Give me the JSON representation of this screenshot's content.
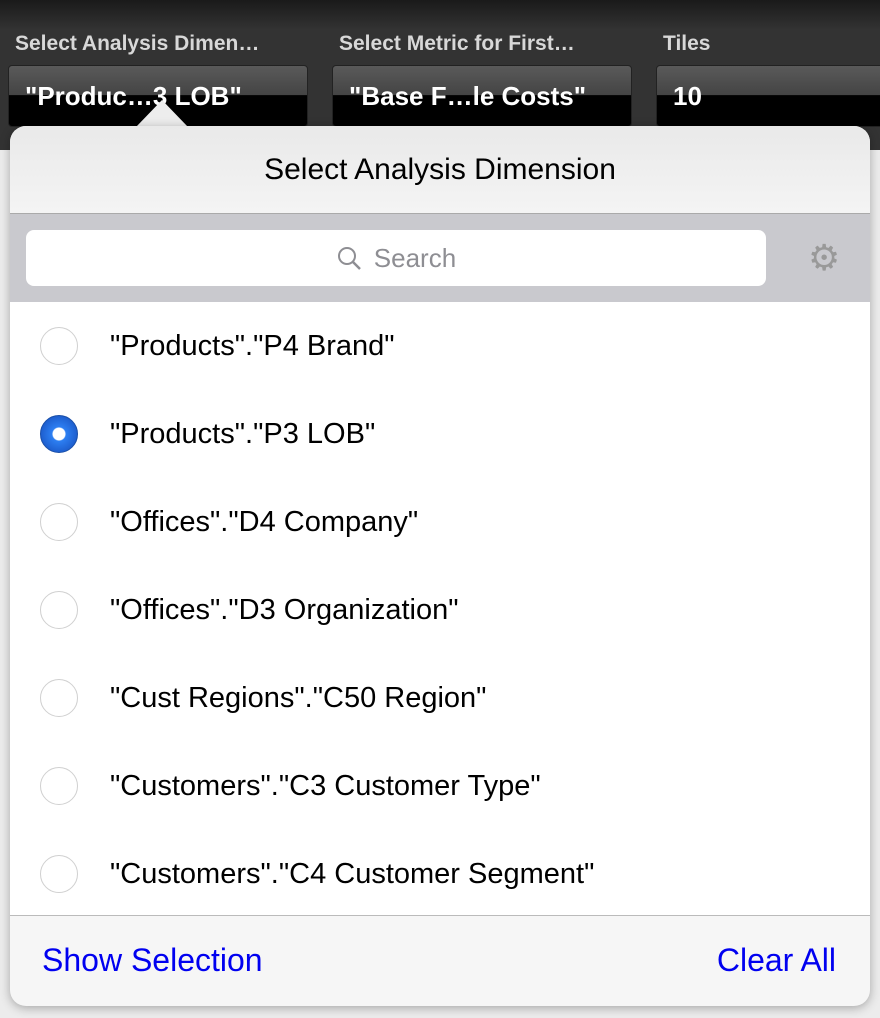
{
  "prompts": [
    {
      "label": "Select Analysis Dimen…",
      "value": "\"Produc…3  LOB\""
    },
    {
      "label": "Select Metric for First…",
      "value": "\"Base F…le Costs\""
    },
    {
      "label": "Tiles",
      "value": "10"
    }
  ],
  "popover": {
    "title": "Select Analysis Dimension",
    "search_placeholder": "Search",
    "items": [
      {
        "label": "\"Products\".\"P4  Brand\"",
        "selected": false
      },
      {
        "label": "\"Products\".\"P3  LOB\"",
        "selected": true
      },
      {
        "label": "\"Offices\".\"D4  Company\"",
        "selected": false
      },
      {
        "label": "\"Offices\".\"D3  Organization\"",
        "selected": false
      },
      {
        "label": "\"Cust Regions\".\"C50  Region\"",
        "selected": false
      },
      {
        "label": "\"Customers\".\"C3  Customer Type\"",
        "selected": false
      },
      {
        "label": "\"Customers\".\"C4  Customer Segment\"",
        "selected": false
      }
    ],
    "show_selection": "Show Selection",
    "clear_all": "Clear All"
  },
  "colors": {
    "accent": "#0000f0",
    "radio_selected": "#2d7ff2"
  }
}
